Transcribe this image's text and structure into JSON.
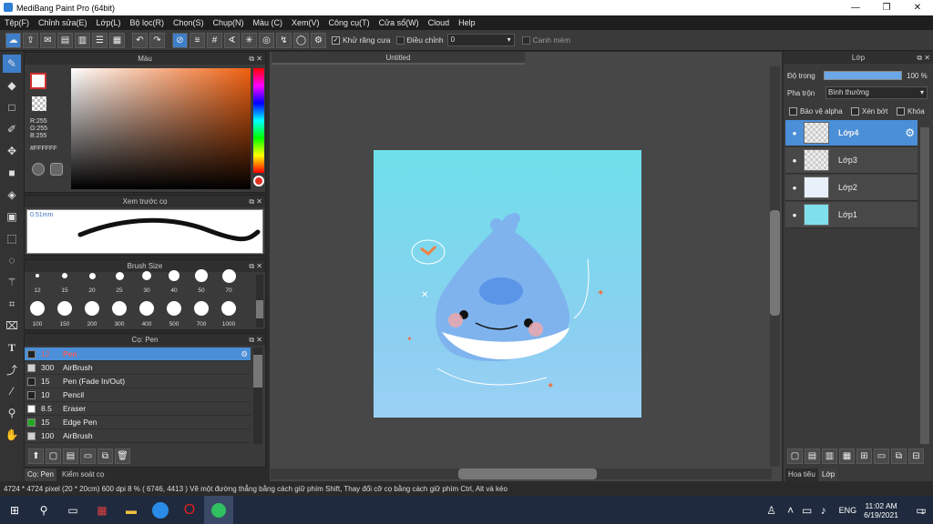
{
  "window": {
    "title": "MediBang Paint Pro (64bit)",
    "min": "—",
    "max": "❐",
    "close": "✕"
  },
  "menu": [
    "Tệp(F)",
    "Chỉnh sửa(E)",
    "Lớp(L)",
    "Bộ lọc(R)",
    "Chọn(S)",
    "Chụp(N)",
    "Màu (C)",
    "Xem(V)",
    "Công cụ(T)",
    "Cửa sổ(W)",
    "Cloud",
    "Help"
  ],
  "toolbar": {
    "antialias_label": "Khử răng cưa",
    "correction_label": "Điều chỉnh",
    "correction_value": "0",
    "snap_label": "Canh mém"
  },
  "color_panel": {
    "title": "Màu",
    "r": "R:255",
    "g": "G:255",
    "b": "B:255",
    "hex": "#FFFFFF"
  },
  "preview_panel": {
    "title": "Xem trước cọ",
    "size": "0.51mm"
  },
  "brush_size_panel": {
    "title": "Brush Size",
    "row1": [
      "12",
      "15",
      "20",
      "25",
      "30",
      "40",
      "50",
      "70"
    ],
    "row2": [
      "100",
      "150",
      "200",
      "300",
      "400",
      "500",
      "700",
      "1000"
    ]
  },
  "brush_panel": {
    "title": "Cọ: Pen",
    "items": [
      {
        "size": "12",
        "name": "Pen",
        "color": "#222222"
      },
      {
        "size": "300",
        "name": "AirBrush",
        "color": "#d0d0d0"
      },
      {
        "size": "15",
        "name": "Pen (Fade In/Out)",
        "color": "#222222"
      },
      {
        "size": "10",
        "name": "Pencil",
        "color": "#222222"
      },
      {
        "size": "8.5",
        "name": "Eraser",
        "color": "#ffffff"
      },
      {
        "size": "15",
        "name": "Edge Pen",
        "color": "#22aa22"
      },
      {
        "size": "100",
        "name": "AirBrush",
        "color": "#d0d0d0"
      }
    ],
    "tab1": "Cọ: Pen",
    "tab2": "Kiểm soát cọ"
  },
  "document": {
    "tab": "Untitled"
  },
  "layer_panel": {
    "title": "Lớp",
    "opacity_label": "Độ trong",
    "opacity_value": "100 %",
    "blend_label": "Pha trộn",
    "blend_value": "Bình thường",
    "protect_alpha": "Bảo vệ alpha",
    "clipping": "Xén bớt",
    "lock": "Khóa",
    "layers": [
      "Lớp4",
      "Lớp3",
      "Lớp2",
      "Lớp1"
    ],
    "tab1": "Hoa tiêu",
    "tab2": "Lớp"
  },
  "status": "4724 * 4724 pixel   (20 * 20cm)   600 dpi   8 %   ( 6746, 4413 )   Vẽ một đường thẳng bằng cách giữ phím Shift, Thay đổi cỡ cọ bằng cách giữ phím Ctrl, Alt và kéo",
  "taskbar": {
    "lang": "ENG",
    "time": "11:02 AM",
    "date": "6/19/2021",
    "notif": "1"
  }
}
